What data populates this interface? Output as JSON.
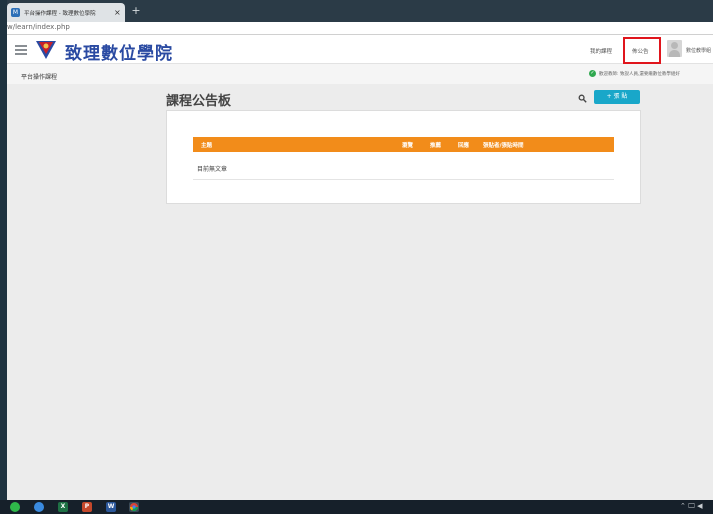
{
  "browser": {
    "tab_title": "平台操作課程 - 致理數位學院",
    "tab_close": "×",
    "new_tab": "+",
    "favicon_text": "M",
    "url": "w/learn/index.php"
  },
  "header": {
    "site_title": "致理數位學院",
    "nav_my_courses": "我的課程",
    "nav_bulletin": "佈公告",
    "user_name": "數位教學組"
  },
  "subheader": {
    "breadcrumb": "平台操作課程",
    "notice": "歡迎教師: 致說人員,還要繼數位教學組好"
  },
  "board": {
    "title": "課程公告板",
    "post_button": "+ 張 貼",
    "columns": {
      "subject": "主題",
      "views": "瀏覽",
      "recommend": "推薦",
      "replies": "回應",
      "poster_time": "張貼者/張貼時間"
    },
    "empty_message": "目前無文章"
  },
  "colors": {
    "accent_orange": "#f28c1a",
    "post_button": "#19a7c9",
    "title_blue": "#2a4aa2",
    "highlight_red": "#e0151c"
  },
  "taskbar": {
    "icons": [
      "line-icon",
      "edge-icon",
      "excel-icon",
      "powerpoint-icon",
      "word-icon",
      "chrome-icon"
    ]
  }
}
